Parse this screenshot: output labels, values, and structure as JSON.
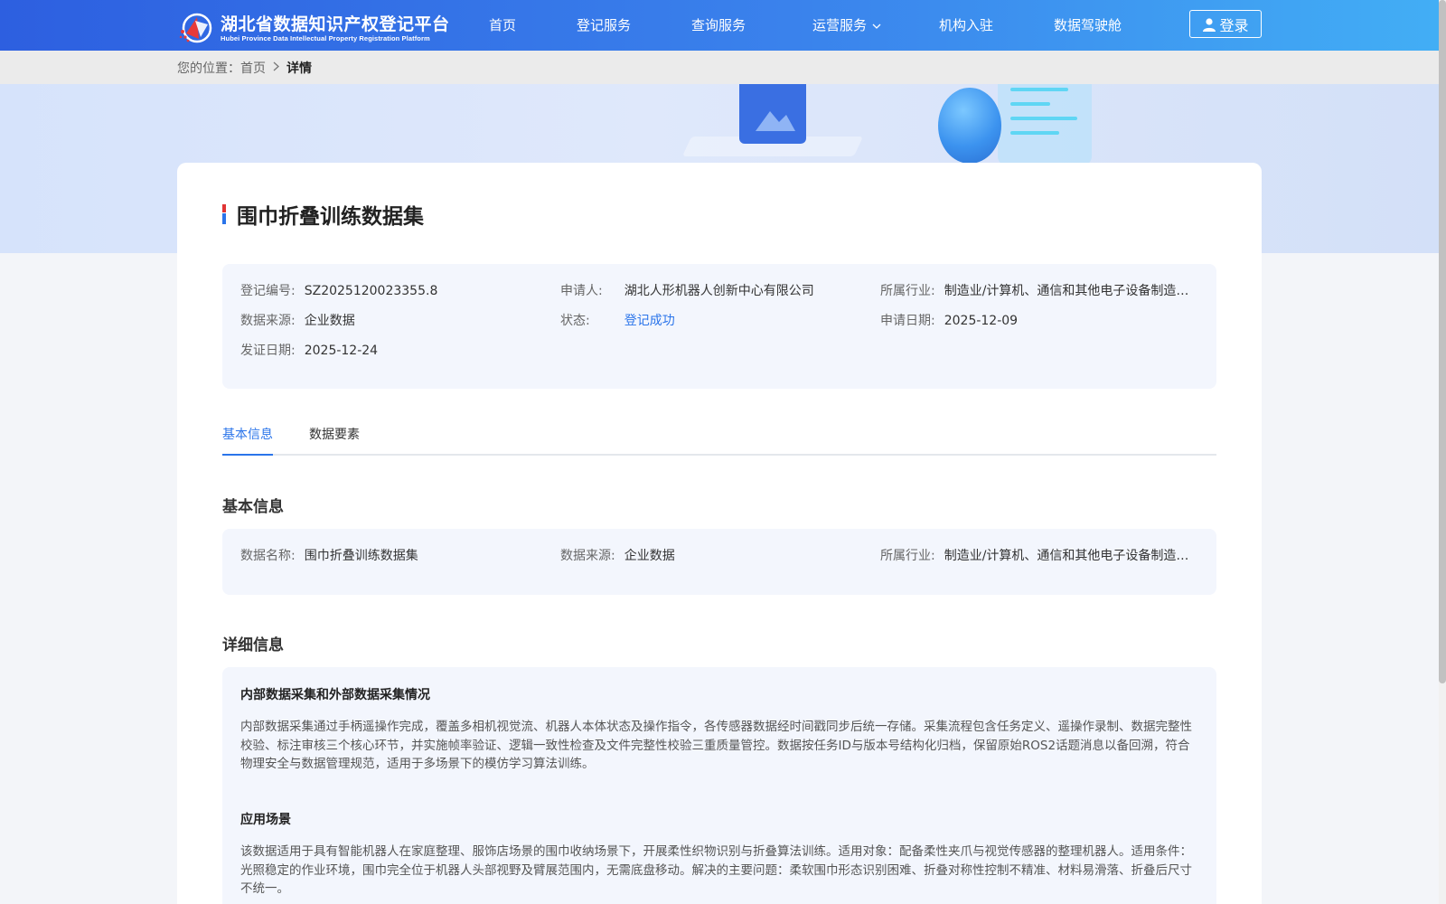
{
  "header": {
    "logo_cn": "湖北省数据知识产权登记平台",
    "logo_en": "Hubei Province Data Intellectual Property Registration Platform",
    "nav": [
      {
        "label": "首页"
      },
      {
        "label": "登记服务"
      },
      {
        "label": "查询服务"
      },
      {
        "label": "运营服务"
      },
      {
        "label": "机构入驻"
      },
      {
        "label": "数据驾驶舱"
      }
    ],
    "login_label": "登录"
  },
  "breadcrumb": {
    "prefix": "您的位置：",
    "home": "首页",
    "current": "详情"
  },
  "detail": {
    "title": "围巾折叠训练数据集",
    "summary": [
      {
        "label": "登记编号:",
        "value": "SZ2025120023355.8"
      },
      {
        "label": "申请人:",
        "value": "湖北人形机器人创新中心有限公司"
      },
      {
        "label": "所属行业:",
        "value": "制造业/计算机、通信和其他电子设备制造…"
      },
      {
        "label": "数据来源:",
        "value": "企业数据"
      },
      {
        "label": "状态:",
        "value": "登记成功"
      },
      {
        "label": "申请日期:",
        "value": "2025-12-09"
      },
      {
        "label": "发证日期:",
        "value": "2025-12-24"
      }
    ]
  },
  "tabs": [
    {
      "label": "基本信息",
      "active": true
    },
    {
      "label": "数据要素",
      "active": false
    }
  ],
  "basic_info": {
    "heading": "基本信息",
    "fields": [
      {
        "label": "数据名称:",
        "value": "围巾折叠训练数据集"
      },
      {
        "label": "数据来源:",
        "value": "企业数据"
      },
      {
        "label": "所属行业:",
        "value": "制造业/计算机、通信和其他电子设备制造…"
      }
    ]
  },
  "detail_info": {
    "heading": "详细信息",
    "sections": [
      {
        "title": "内部数据采集和外部数据采集情况",
        "text": "内部数据采集通过手柄遥操作完成，覆盖多相机视觉流、机器人本体状态及操作指令，各传感器数据经时间戳同步后统一存储。采集流程包含任务定义、遥操作录制、数据完整性校验、标注审核三个核心环节，并实施帧率验证、逻辑一致性检查及文件完整性校验三重质量管控。数据按任务ID与版本号结构化归档，保留原始ROS2话题消息以备回溯，符合物理安全与数据管理规范，适用于多场景下的模仿学习算法训练。"
      },
      {
        "title": "应用场景",
        "text": "该数据适用于具有智能机器人在家庭整理、服饰店场景的围巾收纳场景下，开展柔性织物识别与折叠算法训练。适用对象：配备柔性夹爪与视觉传感器的整理机器人。适用条件：光照稳定的作业环境，围巾完全位于机器人头部视野及臂展范围内，无需底盘移动。解决的主要问题：柔软围巾形态识别困难、折叠对称性控制不精准、材料易滑落、折叠后尺寸不统一。"
      }
    ]
  },
  "colors": {
    "header_start": "#2d5fe0",
    "header_end": "#42aef5",
    "accent_blue": "#2a74ea",
    "box_bg": "#f3f6fd"
  }
}
